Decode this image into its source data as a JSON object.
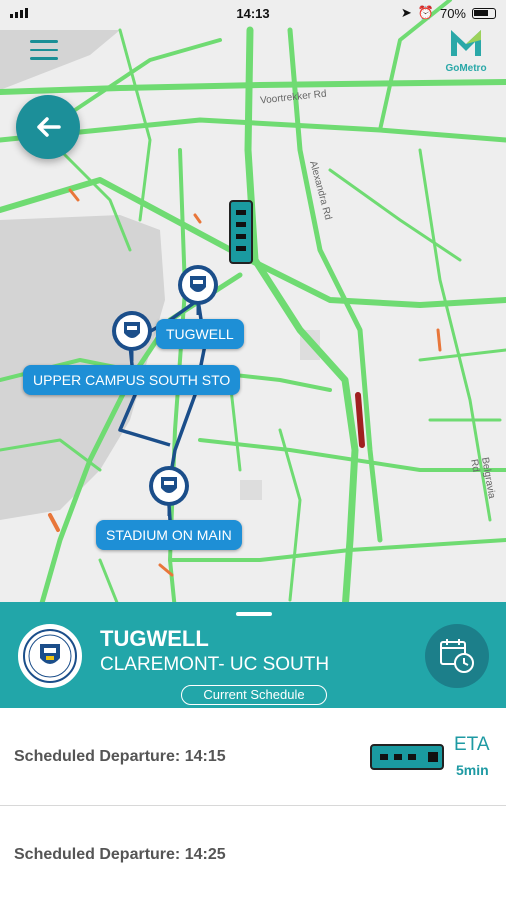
{
  "status_bar": {
    "time": "14:13",
    "battery": "70%"
  },
  "brand": {
    "name": "GoMetro"
  },
  "map": {
    "road_labels": [
      "Voortrekker Rd",
      "Alexandra Rd",
      "Belgravia Rd"
    ],
    "stops": [
      {
        "name": "TUGWELL"
      },
      {
        "name": "UPPER CAMPUS SOUTH STO"
      },
      {
        "name": "STADIUM ON MAIN"
      }
    ]
  },
  "panel": {
    "stop_name": "TUGWELL",
    "route_name": "CLAREMONT- UC SOUTH",
    "schedule_button": "Current Schedule"
  },
  "departures": [
    {
      "label": "Scheduled Departure: 14:15",
      "eta_label": "ETA",
      "eta_value": "5min"
    },
    {
      "label": "Scheduled Departure: 14:25"
    }
  ],
  "icons": {
    "menu": "hamburger-icon",
    "back": "arrow-left-icon",
    "schedule": "calendar-clock-icon",
    "bus": "bus-icon",
    "stop": "university-crest-icon"
  },
  "colors": {
    "teal": "#22a6a9",
    "road_green": "#6fdb72",
    "route_blue": "#1b4e8a",
    "label_blue": "#1e8fd6",
    "traffic_red": "#c0392b"
  }
}
